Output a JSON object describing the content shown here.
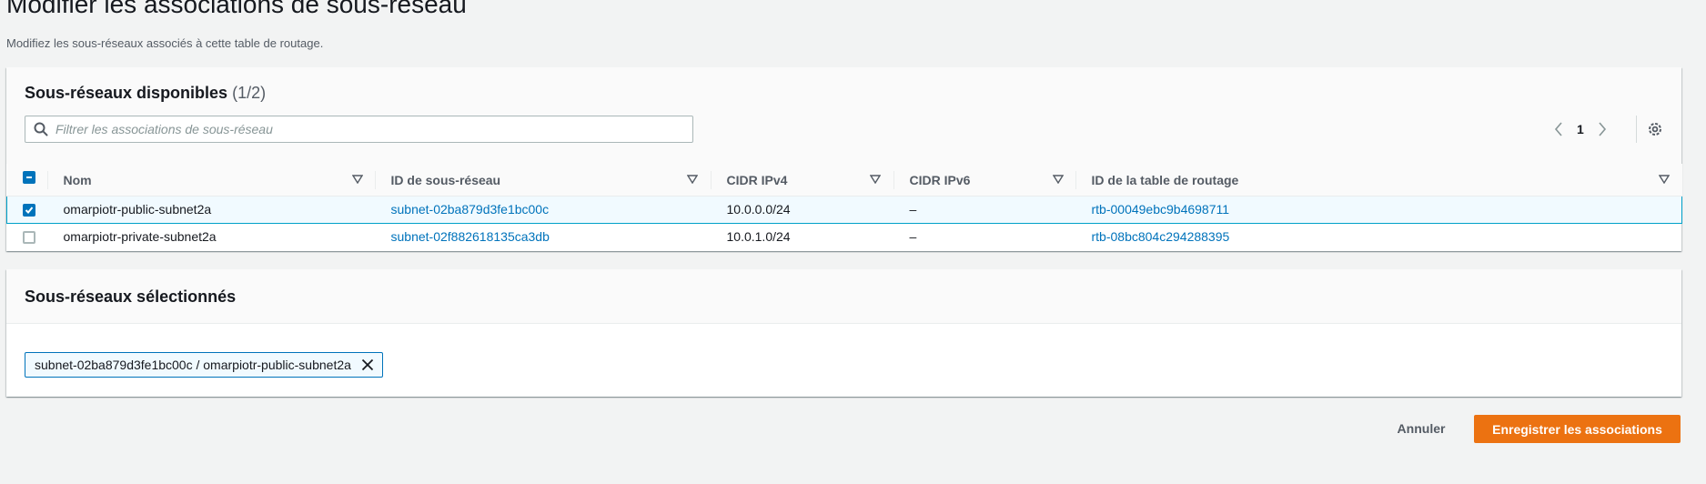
{
  "page": {
    "title": "Modifier les associations de sous-réseau",
    "description": "Modifiez les sous-réseaux associés à cette table de routage."
  },
  "available": {
    "title": "Sous-réseaux disponibles",
    "count": "(1/2)",
    "search_placeholder": "Filtrer les associations de sous-réseau",
    "page_number": "1",
    "columns": [
      "Nom",
      "ID de sous-réseau",
      "CIDR IPv4",
      "CIDR IPv6",
      "ID de la table de routage"
    ],
    "rows": [
      {
        "selected": true,
        "name": "omarpiotr-public-subnet2a",
        "subnet_id": "subnet-02ba879d3fe1bc00c",
        "cidr_ipv4": "10.0.0.0/24",
        "cidr_ipv6": "–",
        "route_table_id": "rtb-00049ebc9b4698711"
      },
      {
        "selected": false,
        "name": "omarpiotr-private-subnet2a",
        "subnet_id": "subnet-02f882618135ca3db",
        "cidr_ipv4": "10.0.1.0/24",
        "cidr_ipv6": "–",
        "route_table_id": "rtb-08bc804c294288395"
      }
    ]
  },
  "selected": {
    "title": "Sous-réseaux sélectionnés",
    "tokens": [
      "subnet-02ba879d3fe1bc00c / omarpiotr-public-subnet2a"
    ]
  },
  "actions": {
    "cancel_label": "Annuler",
    "save_label": "Enregistrer les associations"
  },
  "colors": {
    "primary": "#ec7211",
    "link": "#0073bb",
    "selection": "#00a1c9"
  },
  "icons": {
    "search": "search-icon",
    "prev": "chevron-left-icon",
    "next": "chevron-right-icon",
    "settings": "gear-icon",
    "sort": "caret-down-icon",
    "remove": "close-icon"
  }
}
